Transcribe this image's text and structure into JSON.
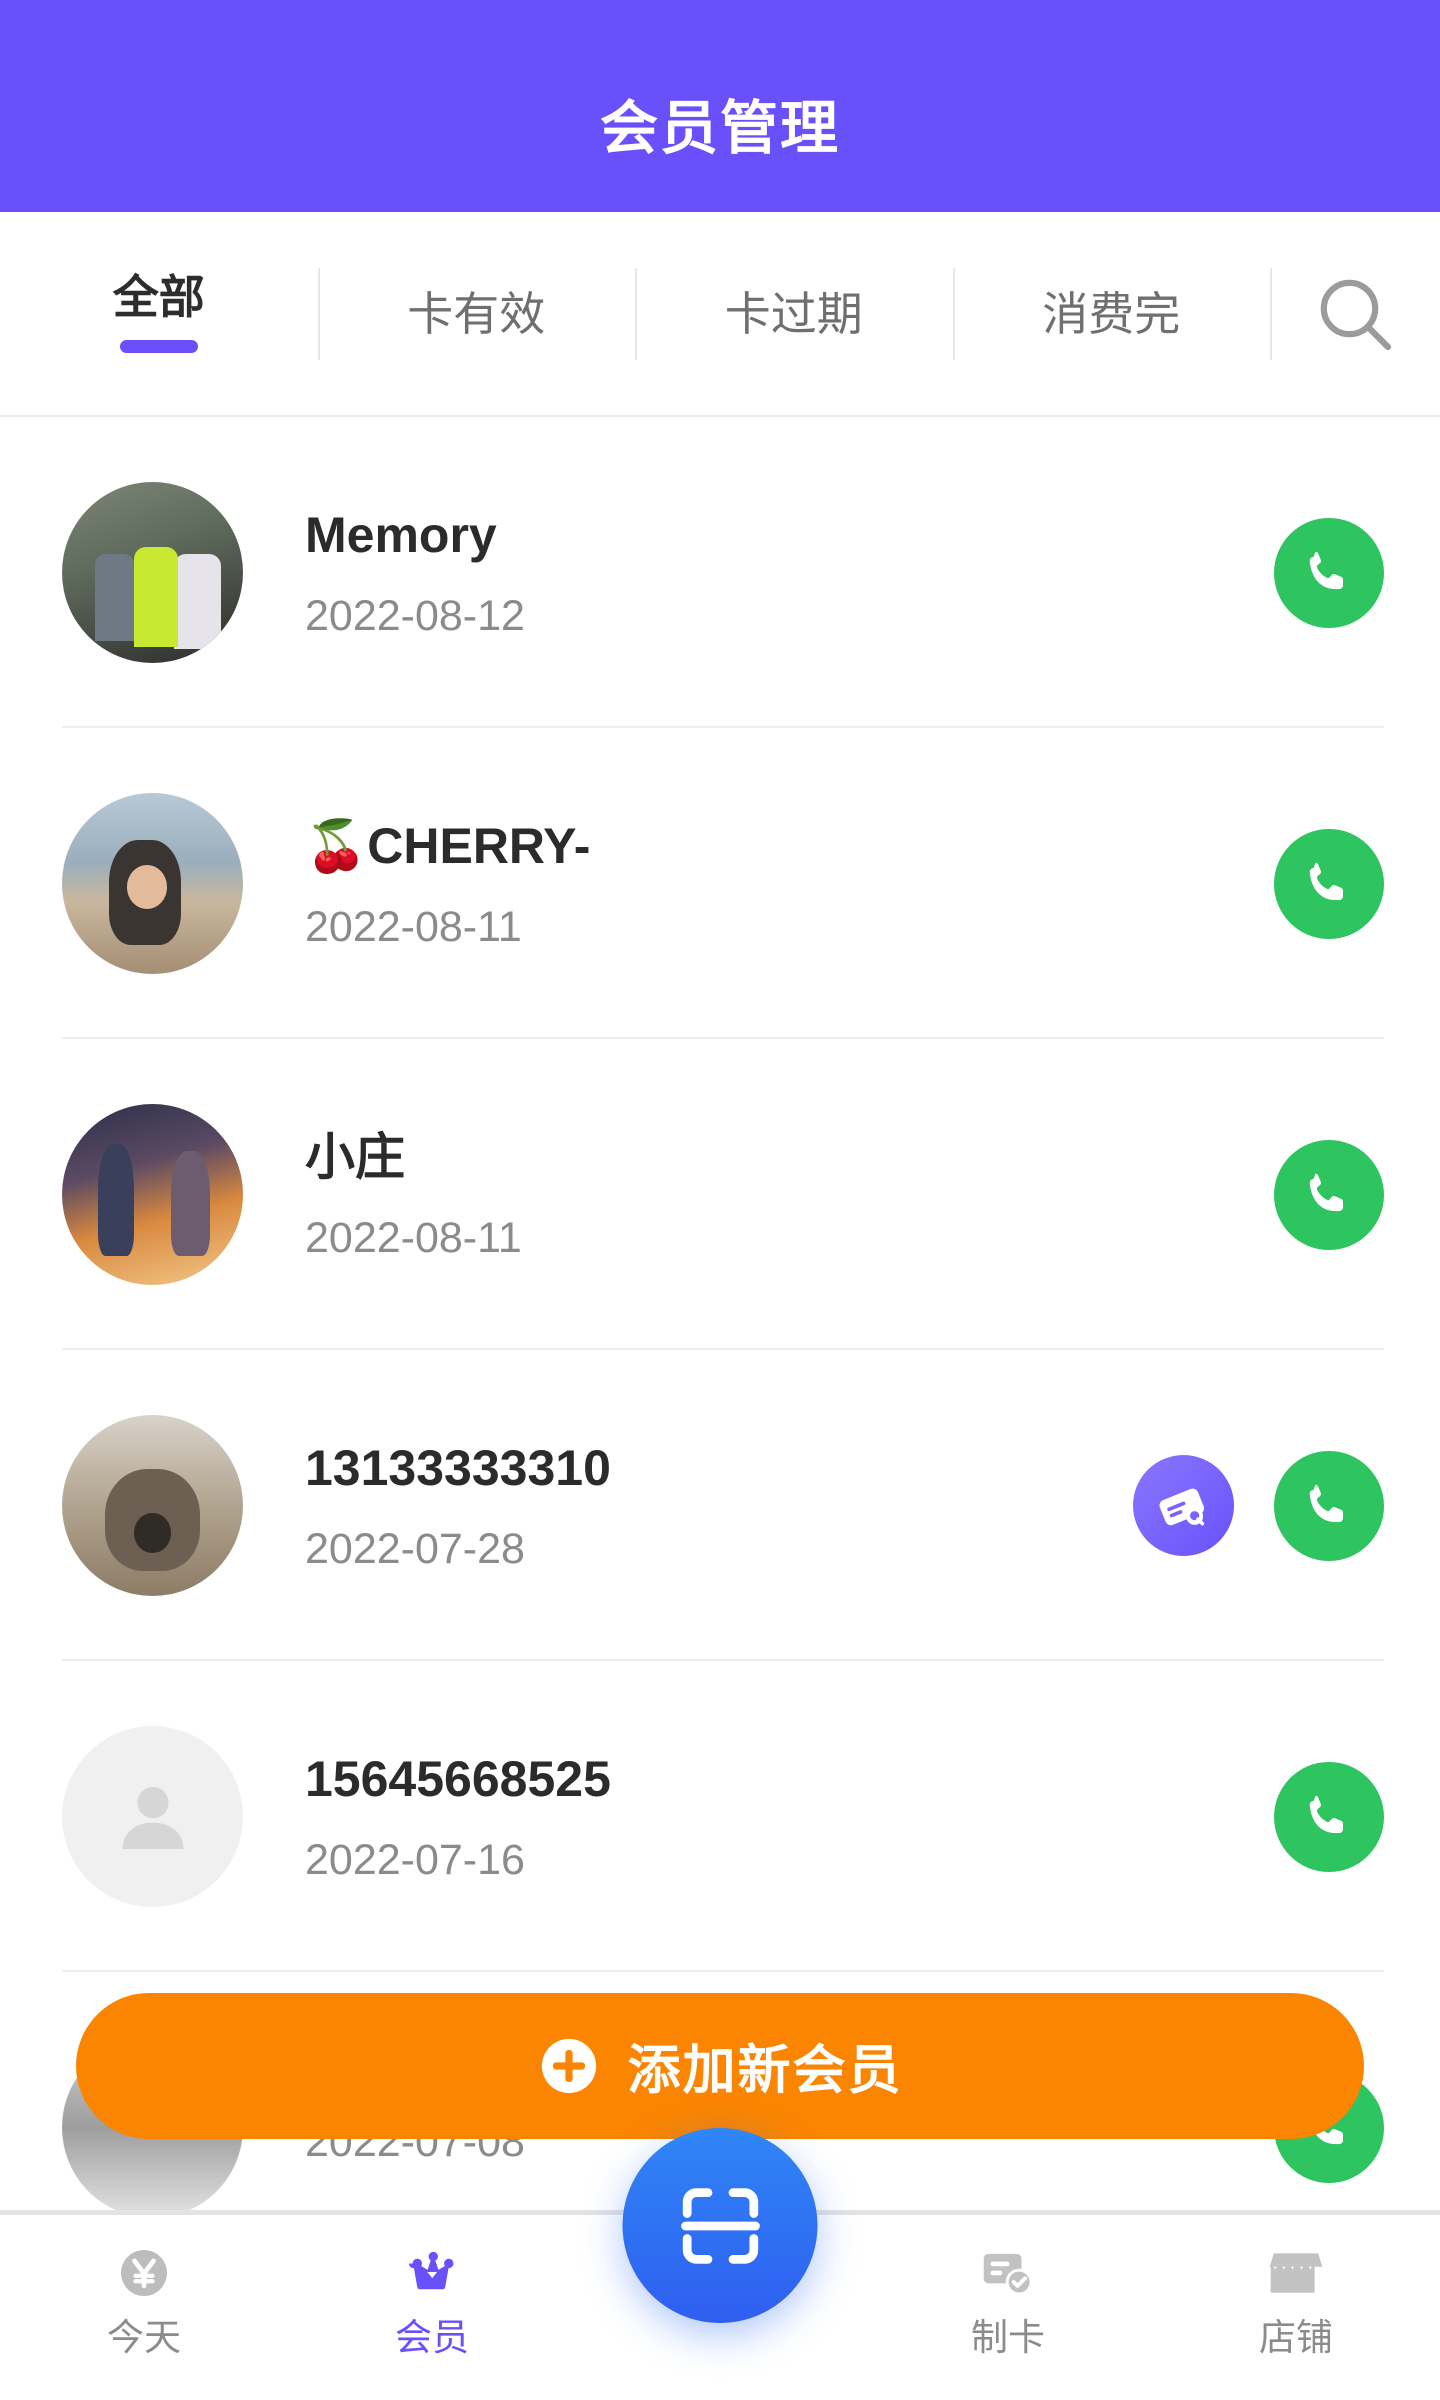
{
  "header": {
    "title": "会员管理"
  },
  "tabs": [
    {
      "label": "全部",
      "active": true
    },
    {
      "label": "卡有效",
      "active": false
    },
    {
      "label": "卡过期",
      "active": false
    },
    {
      "label": "消费完",
      "active": false
    }
  ],
  "search": {
    "icon": "search-icon"
  },
  "members": [
    {
      "name": "Memory",
      "date": "2022-08-12",
      "avatar": "photo-group",
      "has_card_button": false,
      "call_icon": "phone-icon"
    },
    {
      "name": "🍒CHERRY-",
      "date": "2022-08-11",
      "avatar": "photo-beach",
      "has_card_button": false,
      "call_icon": "phone-icon"
    },
    {
      "name": "小庄",
      "date": "2022-08-11",
      "avatar": "photo-sunset",
      "has_card_button": false,
      "call_icon": "phone-icon"
    },
    {
      "name": "13133333310",
      "date": "2022-07-28",
      "avatar": "photo-dog",
      "has_card_button": true,
      "card_icon": "card-search-icon",
      "call_icon": "phone-icon"
    },
    {
      "name": "15645668525",
      "date": "2022-07-16",
      "avatar": "default-person",
      "has_card_button": false,
      "call_icon": "phone-icon"
    },
    {
      "name": "",
      "date": "2022-07-08",
      "avatar": "photo-misc",
      "has_card_button": false,
      "call_icon": "phone-icon"
    }
  ],
  "add_button": {
    "label": "添加新会员",
    "icon": "plus-circle-icon"
  },
  "fab": {
    "icon": "scan-icon"
  },
  "bottom_nav": [
    {
      "label": "今天",
      "icon": "yen-circle-icon",
      "active": false
    },
    {
      "label": "会员",
      "icon": "crown-icon",
      "active": true
    },
    {
      "label": "制卡",
      "icon": "card-check-icon",
      "active": false
    },
    {
      "label": "店铺",
      "icon": "store-icon",
      "active": false
    }
  ],
  "colors": {
    "header_purple": "#6950fb",
    "accent_purple": "#6950fb",
    "call_green": "#2ec45f",
    "add_orange": "#fb8500",
    "fab_blue": "#2f5ef0",
    "inactive_gray": "#8b8b8b"
  }
}
